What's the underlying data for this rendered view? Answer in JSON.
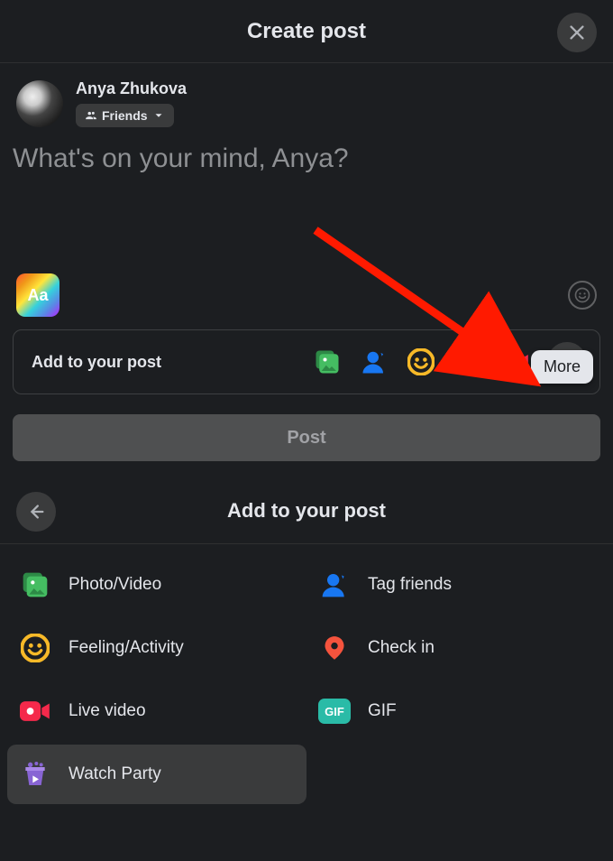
{
  "header": {
    "title": "Create post"
  },
  "user": {
    "name": "Anya Zhukova"
  },
  "privacy": {
    "label": "Friends"
  },
  "composer": {
    "placeholder": "What's on your mind, Anya?"
  },
  "bgChip": {
    "label": "Aa"
  },
  "addBar": {
    "label": "Add to your post"
  },
  "tooltip": {
    "label": "More"
  },
  "postButton": {
    "label": "Post"
  },
  "panel2": {
    "title": "Add to your post"
  },
  "options": {
    "photo": "Photo/Video",
    "tag": "Tag friends",
    "feeling": "Feeling/Activity",
    "checkin": "Check in",
    "live": "Live video",
    "gif_badge": "GIF",
    "gif": "GIF",
    "watchparty": "Watch Party"
  },
  "colors": {
    "photo": "#45bd62",
    "tag": "#1877f2",
    "feeling": "#f7b928",
    "checkin": "#f5533d",
    "live": "#f5294b",
    "gif": "#2abba7",
    "watchparty": "#8864d4"
  }
}
